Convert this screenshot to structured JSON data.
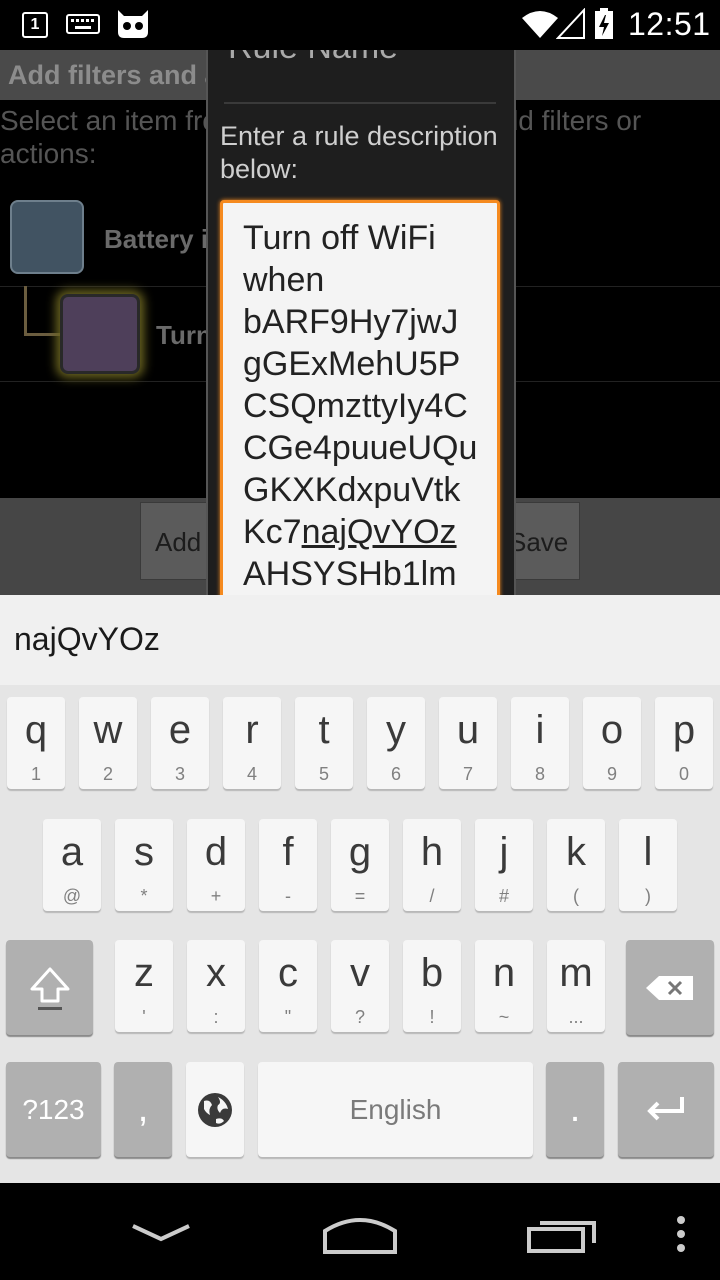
{
  "status_bar": {
    "notification_count": "1",
    "time": "12:51",
    "icons": [
      "notification-icon",
      "keyboard-icon",
      "cyanogenmod-icon",
      "wifi-icon",
      "signal-icon",
      "battery-charging-icon"
    ]
  },
  "app": {
    "title": "Add filters and actions to your rule",
    "instructions": "Select an item from the list below, then add filters or actions:",
    "items": [
      {
        "label": "Battery is",
        "icon": "battery-filter-icon"
      },
      {
        "label": "Turn",
        "icon": "action-icon"
      }
    ],
    "buttons": {
      "add": "Add",
      "save": "Save"
    }
  },
  "dialog": {
    "title": "Rule Name",
    "prompt": "Enter a rule description below:",
    "field_lines": [
      "Turn off WiFi",
      "when",
      "bARF9Hy7jwJ",
      "gGExMehU5P",
      "CSQmzttyIy4C",
      "CGe4puueUQu",
      "GKXKdxpuVtk"
    ],
    "field_line_prefix": "Kc7",
    "field_composing": "najQvYOz",
    "field_last_line": "AHSYSHb1lm"
  },
  "suggestion": {
    "word": "najQvYOz"
  },
  "keyboard": {
    "row1": [
      {
        "key": "q",
        "sub": "1"
      },
      {
        "key": "w",
        "sub": "2"
      },
      {
        "key": "e",
        "sub": "3"
      },
      {
        "key": "r",
        "sub": "4"
      },
      {
        "key": "t",
        "sub": "5"
      },
      {
        "key": "y",
        "sub": "6"
      },
      {
        "key": "u",
        "sub": "7"
      },
      {
        "key": "i",
        "sub": "8"
      },
      {
        "key": "o",
        "sub": "9"
      },
      {
        "key": "p",
        "sub": "0"
      }
    ],
    "row2": [
      {
        "key": "a",
        "sub": "@"
      },
      {
        "key": "s",
        "sub": "*"
      },
      {
        "key": "d",
        "sub": "+"
      },
      {
        "key": "f",
        "sub": "-"
      },
      {
        "key": "g",
        "sub": "="
      },
      {
        "key": "h",
        "sub": "/"
      },
      {
        "key": "j",
        "sub": "#"
      },
      {
        "key": "k",
        "sub": "("
      },
      {
        "key": "l",
        "sub": ")"
      }
    ],
    "row3": [
      {
        "key": "z",
        "sub": "'"
      },
      {
        "key": "x",
        "sub": ":"
      },
      {
        "key": "c",
        "sub": "\""
      },
      {
        "key": "v",
        "sub": "?"
      },
      {
        "key": "b",
        "sub": "!"
      },
      {
        "key": "n",
        "sub": "~"
      },
      {
        "key": "m",
        "sub": "..."
      }
    ],
    "symbols_label": "?123",
    "comma": ",",
    "space_label": "English",
    "period": ".",
    "icons": [
      "shift-icon",
      "backspace-icon",
      "globe-icon",
      "enter-icon"
    ]
  },
  "nav_bar": {
    "icons": [
      "back-icon",
      "home-icon",
      "recents-icon",
      "menu-icon"
    ]
  }
}
